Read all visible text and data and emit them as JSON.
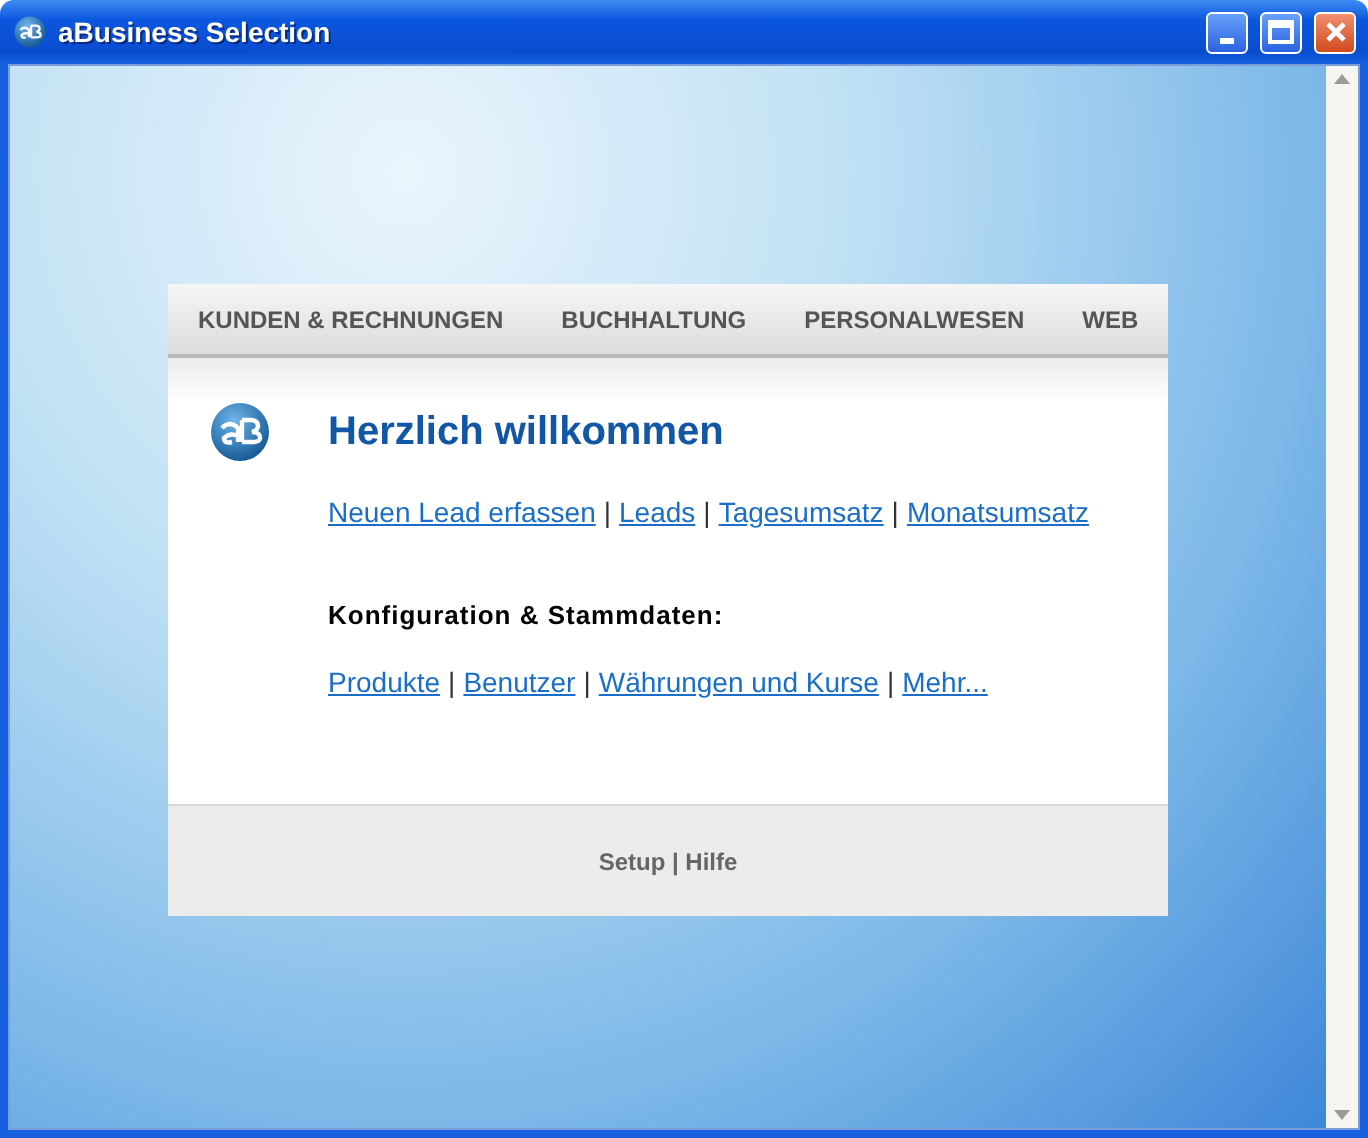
{
  "window": {
    "title": "aBusiness Selection"
  },
  "nav": [
    {
      "label": "KUNDEN & RECHNUNGEN"
    },
    {
      "label": "BUCHHALTUNG"
    },
    {
      "label": "PERSONALWESEN"
    },
    {
      "label": "WEB"
    }
  ],
  "welcome": {
    "heading": "Herzlich willkommen",
    "separator": "|",
    "links": [
      "Neuen Lead erfassen",
      "Leads",
      "Tagesumsatz",
      "Monatsumsatz"
    ]
  },
  "config": {
    "heading": "Konfiguration & Stammdaten:",
    "separator": "|",
    "links": [
      "Produkte",
      "Benutzer",
      "Währungen und Kurse",
      "Mehr..."
    ]
  },
  "footer": {
    "text": "Setup | Hilfe"
  }
}
